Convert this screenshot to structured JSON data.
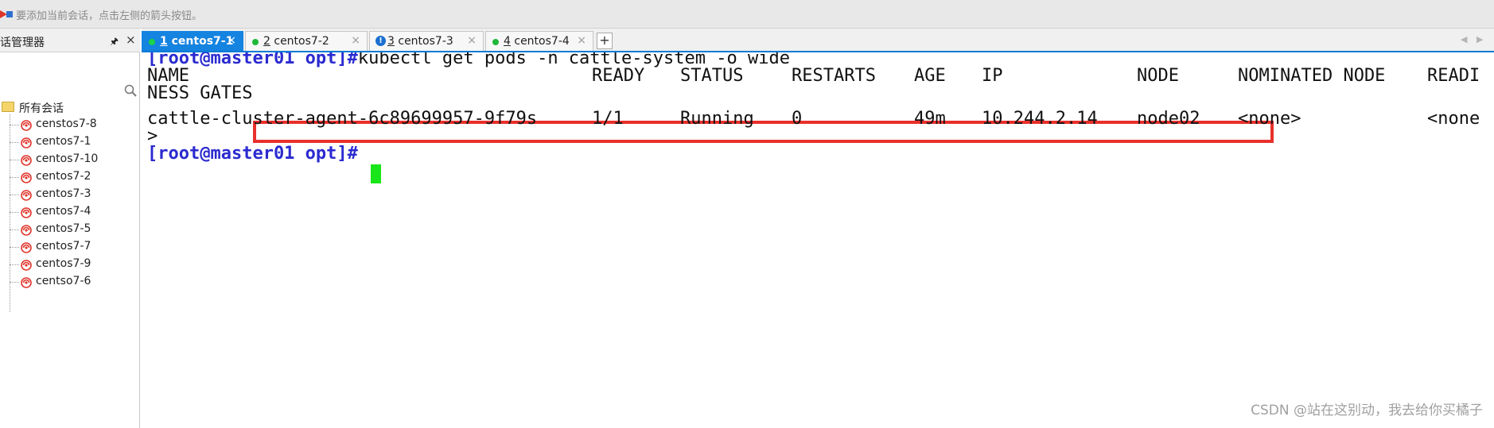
{
  "topbar": {
    "hint_text": "要添加当前会话，点击左侧的箭头按钮。"
  },
  "sidebar": {
    "title": "话管理器",
    "pin_glyph": "🖈",
    "close_glyph": "×",
    "root_label": "所有会话",
    "sessions": [
      {
        "label": "censtos7-8"
      },
      {
        "label": "centos7-1"
      },
      {
        "label": "centos7-10"
      },
      {
        "label": "centos7-2"
      },
      {
        "label": "centos7-3"
      },
      {
        "label": "centos7-4"
      },
      {
        "label": "centos7-5"
      },
      {
        "label": "centos7-7"
      },
      {
        "label": "centos7-9"
      },
      {
        "label": "centso7-6"
      }
    ]
  },
  "tabs": [
    {
      "num": "1",
      "label": "centos7-1",
      "status": "connected",
      "active": true
    },
    {
      "num": "2",
      "label": "centos7-2",
      "status": "connected",
      "active": false
    },
    {
      "num": "3",
      "label": "centos7-3",
      "status": "warning",
      "active": false
    },
    {
      "num": "4",
      "label": "centos7-4",
      "status": "connected",
      "active": false
    }
  ],
  "tab_add_glyph": "+",
  "tab_close_glyph": "×",
  "tab_scroll_left_glyph": "◀",
  "tab_scroll_right_glyph": "▶",
  "terminal": {
    "prompt": "[root@master01 opt]#",
    "command": "kubectl get pods -n cattle-system -o wide",
    "headers": [
      "NAME",
      "READY",
      "STATUS",
      "RESTARTS",
      "AGE",
      "IP",
      "NODE",
      "NOMINATED NODE",
      "READI"
    ],
    "header_wrap": "NESS GATES",
    "row": [
      "cattle-cluster-agent-6c89699957-9f79s",
      "1/1",
      "Running",
      "0",
      "49m",
      "10.244.2.14",
      "node02",
      "<none>",
      "<none"
    ],
    "row_wrap": ">",
    "prompt2": "[root@master01 opt]#"
  },
  "colors": {
    "prompt": "#2a2ad0",
    "cursor": "#19e619",
    "highlight": "#e8302c",
    "active_tab": "#1583e0"
  },
  "watermark": "CSDN @站在这别动，我去给你买橘子"
}
